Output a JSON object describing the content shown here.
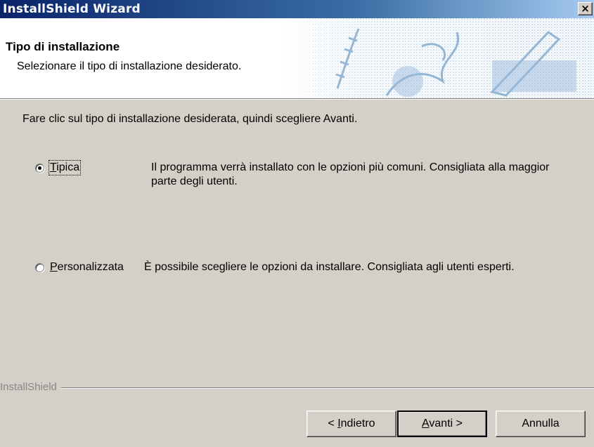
{
  "window": {
    "title": "InstallShield Wizard",
    "close_glyph": "×"
  },
  "header": {
    "title": "Tipo di installazione",
    "subtitle": "Selezionare il tipo di installazione desiderato.",
    "graphic_icon": "installshield-banner-graphic",
    "graphic_color": "#a6c4e0"
  },
  "instruction": "Fare clic sul tipo di installazione desiderata, quindi scegliere Avanti.",
  "options": [
    {
      "label_prefix": "",
      "label_mnemonic": "T",
      "label_rest": "ipica",
      "description": "Il programma verrà installato con le opzioni più comuni.  Consigliata alla maggior parte degli utenti.",
      "selected": true
    },
    {
      "label_prefix": "",
      "label_mnemonic": "P",
      "label_rest": "ersonalizzata",
      "description": "È possibile scegliere le opzioni da installare. Consigliata agli utenti esperti.",
      "selected": false
    }
  ],
  "brand": "InstallShield",
  "buttons": {
    "back": {
      "prefix": "< ",
      "mnemonic": "I",
      "rest": "ndietro"
    },
    "next": {
      "prefix": "",
      "mnemonic": "A",
      "rest": "vanti >"
    },
    "cancel": {
      "label": "Annulla"
    }
  }
}
